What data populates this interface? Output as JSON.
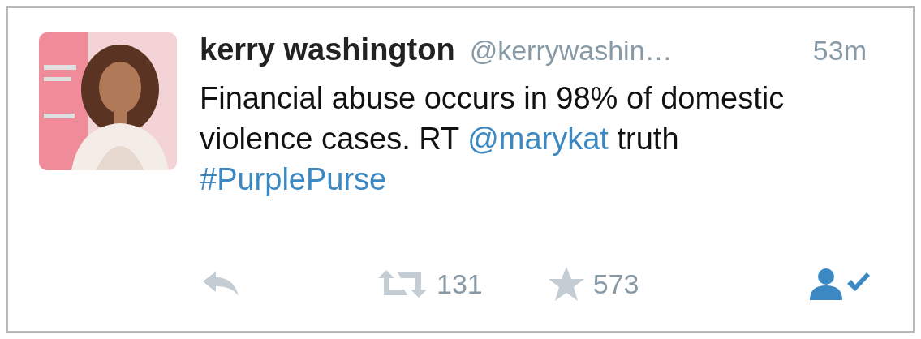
{
  "tweet": {
    "name": "kerry washington",
    "handle": "@kerrywashin…",
    "time": "53m",
    "text": [
      {
        "kind": "text",
        "text": "Financial abuse occurs in 98% of domestic violence cases. RT "
      },
      {
        "kind": "mention",
        "text": "@marykat"
      },
      {
        "kind": "text",
        "text": " truth "
      },
      {
        "kind": "hashtag",
        "text": "#PurplePurse"
      }
    ],
    "actions": {
      "retweets": "131",
      "favorites": "573"
    }
  }
}
